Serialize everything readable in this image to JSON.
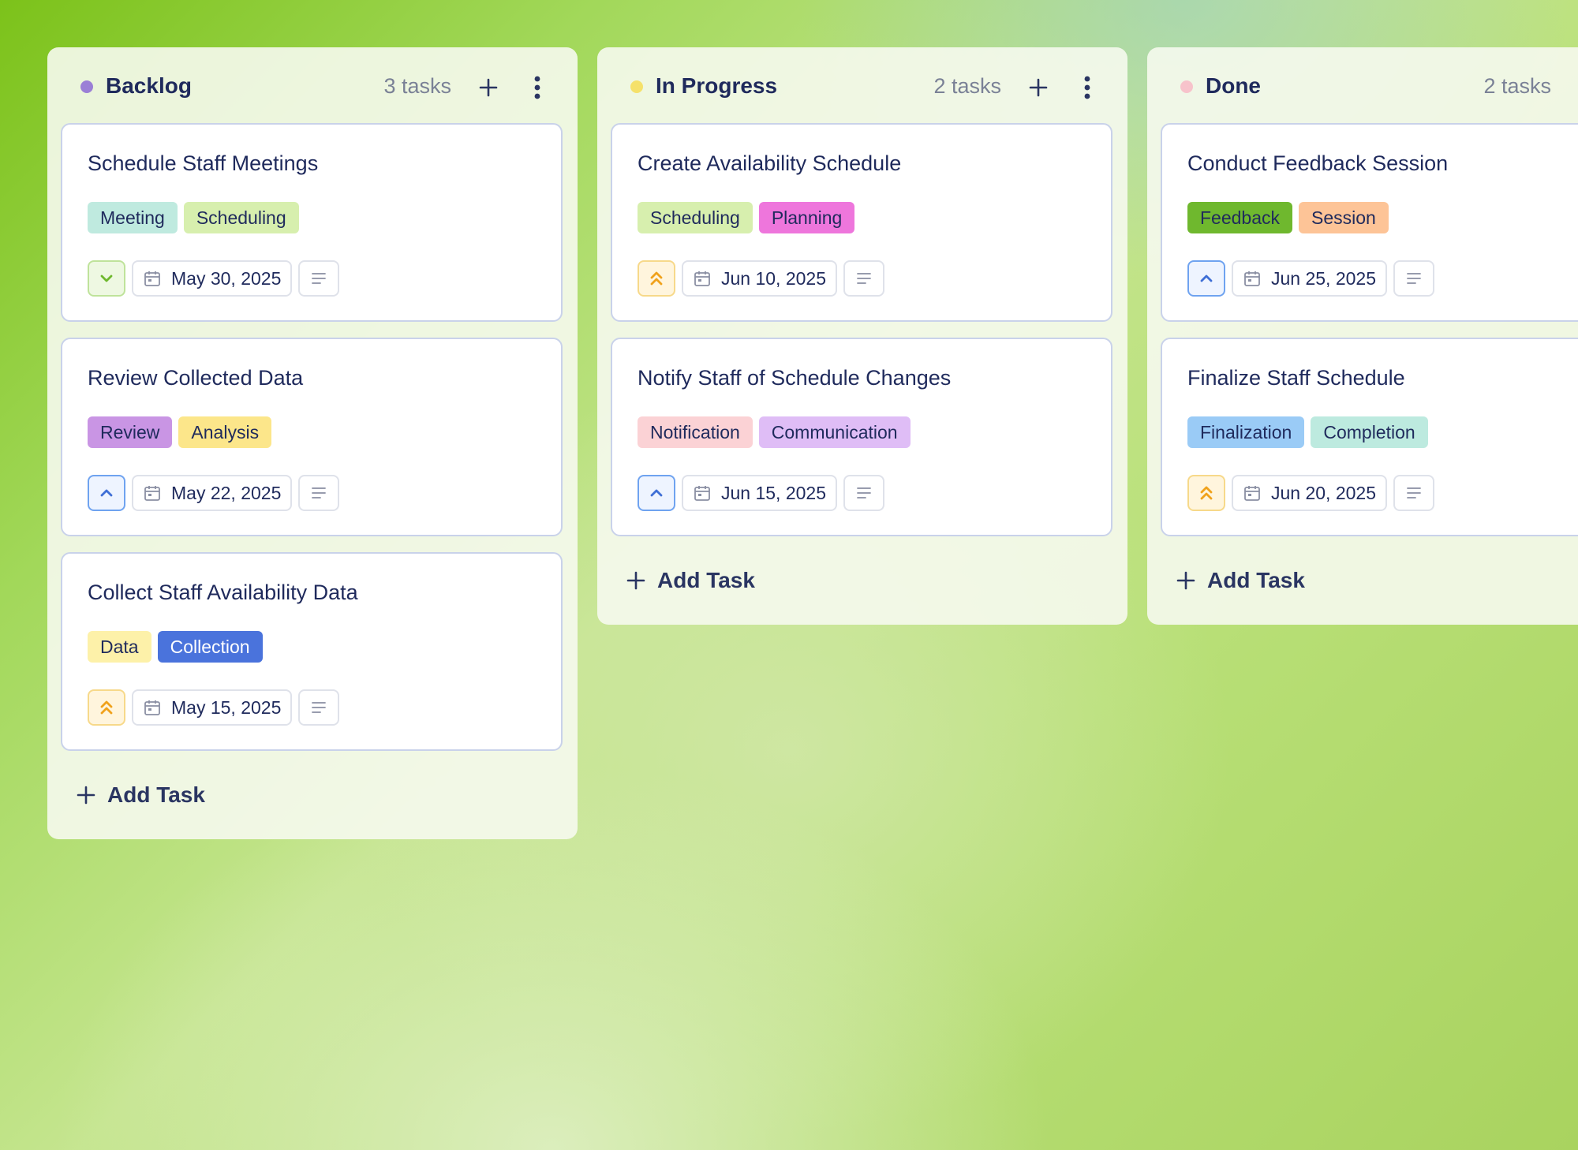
{
  "colors": {
    "backlog_dot": "#9b7fd6",
    "in_progress_dot": "#f5e16a",
    "done_dot": "#f7c3cb",
    "text_primary": "#1f2a5c",
    "text_muted": "#7a8196"
  },
  "columns": [
    {
      "title": "Backlog",
      "count": "3 tasks",
      "dot_color": "#9b7fd6",
      "add_task_label": "Add Task",
      "cards": [
        {
          "title": "Schedule Staff Meetings",
          "priority": "low",
          "priority_icon": "chevron-down-icon",
          "due": "May 30, 2025",
          "tags": [
            {
              "label": "Meeting",
              "bg": "#bfeadf"
            },
            {
              "label": "Scheduling",
              "bg": "#d7efae"
            }
          ]
        },
        {
          "title": "Review Collected Data",
          "priority": "medium",
          "priority_icon": "chevron-up-icon",
          "due": "May 22, 2025",
          "tags": [
            {
              "label": "Review",
              "bg": "#c995e4"
            },
            {
              "label": "Analysis",
              "bg": "#fce68a"
            }
          ]
        },
        {
          "title": "Collect Staff Availability Data",
          "priority": "high",
          "priority_icon": "double-chevron-up-icon",
          "due": "May 15, 2025",
          "tags": [
            {
              "label": "Data",
              "bg": "#fdf1a9"
            },
            {
              "label": "Collection",
              "bg": "#4a73dc",
              "fg": "#ffffff"
            }
          ]
        }
      ]
    },
    {
      "title": "In Progress",
      "count": "2 tasks",
      "dot_color": "#f5e16a",
      "add_task_label": "Add Task",
      "cards": [
        {
          "title": "Create Availability Schedule",
          "priority": "high",
          "priority_icon": "double-chevron-up-icon",
          "due": "Jun 10, 2025",
          "tags": [
            {
              "label": "Scheduling",
              "bg": "#d7efae"
            },
            {
              "label": "Planning",
              "bg": "#ee76dc"
            }
          ]
        },
        {
          "title": "Notify Staff of Schedule Changes",
          "priority": "medium",
          "priority_icon": "chevron-up-icon",
          "due": "Jun 15, 2025",
          "tags": [
            {
              "label": "Notification",
              "bg": "#fbd2d5"
            },
            {
              "label": "Communication",
              "bg": "#dfbdf6"
            }
          ]
        }
      ]
    },
    {
      "title": "Done",
      "count": "2 tasks",
      "dot_color": "#f7c3cb",
      "add_task_label": "Add Task",
      "cards": [
        {
          "title": "Conduct Feedback Session",
          "priority": "medium",
          "priority_icon": "chevron-up-icon",
          "due": "Jun 25, 2025",
          "tags": [
            {
              "label": "Feedback",
              "bg": "#6fb82e"
            },
            {
              "label": "Session",
              "bg": "#fdc497"
            }
          ]
        },
        {
          "title": "Finalize Staff Schedule",
          "priority": "high",
          "priority_icon": "double-chevron-up-icon",
          "due": "Jun 20, 2025",
          "tags": [
            {
              "label": "Finalization",
              "bg": "#9acbf6"
            },
            {
              "label": "Completion",
              "bg": "#bdeadf"
            }
          ]
        }
      ]
    }
  ]
}
